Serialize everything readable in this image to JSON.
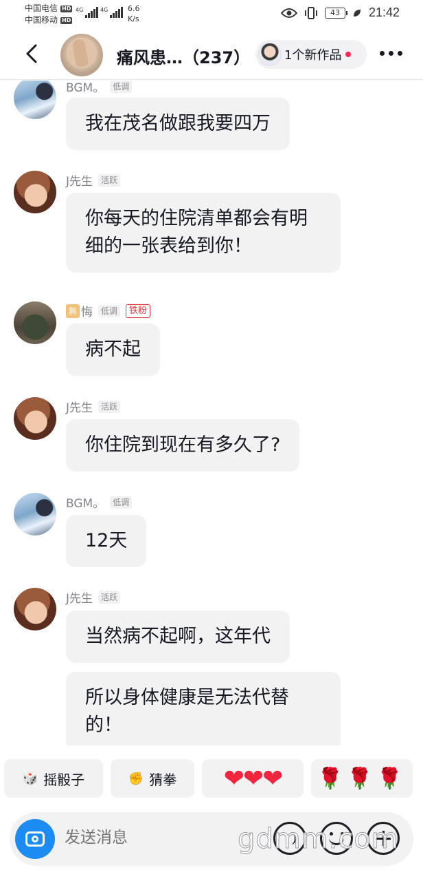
{
  "status_bar": {
    "carrier_1": "中国电信",
    "carrier_2": "中国移动",
    "hd_badge": "HD",
    "network_1": "4G",
    "network_2": "4G",
    "speed_value": "6.6",
    "speed_unit": "K/s",
    "battery": "43",
    "time": "21:42"
  },
  "header": {
    "group_title": "痛风患…（237）",
    "works_label": "1个新作品"
  },
  "messages": [
    {
      "name": "BGM。",
      "level": "低调",
      "text": "我在茂名做跟我要四万"
    },
    {
      "name": "J先生",
      "level": "活跃",
      "text": "你每天的住院清单都会有明细的一张表给到你！"
    },
    {
      "name_prefix": "無",
      "name": "悔",
      "level": "低调",
      "fan_badge": "铁粉",
      "text": "病不起"
    },
    {
      "name": "J先生",
      "level": "活跃",
      "text": "你住院到现在有多久了?"
    },
    {
      "name": "BGM。",
      "level": "低调",
      "text": "12天"
    },
    {
      "name": "J先生",
      "level": "活跃",
      "text": "当然病不起啊，这年代",
      "text_2": "所以身体健康是无法代替的！"
    }
  ],
  "quick_replies": {
    "dice_label": "摇骰子",
    "rps_label": "猜拳",
    "hearts": "❤❤❤",
    "roses": "🌹🌹🌹"
  },
  "input": {
    "placeholder": "发送消息"
  },
  "watermark": "gdmm.com",
  "colors": {
    "accent_blue": "#1c8cf3",
    "notify_red": "#fe2c55",
    "bubble_gray": "#f2f2f3"
  }
}
